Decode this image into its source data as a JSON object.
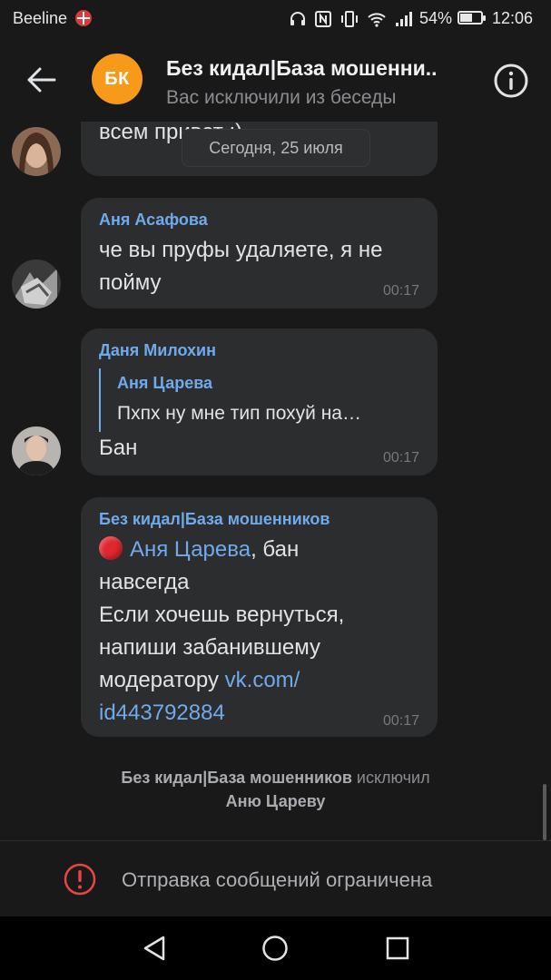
{
  "status_bar": {
    "carrier": "Beeline",
    "battery": "54%",
    "time": "12:06"
  },
  "header": {
    "avatar_initials": "БК",
    "avatar_color": "#f79a1a",
    "title": "Без кидал|База мошенни..",
    "subtitle": "Вас исключили из беседы"
  },
  "feed": {
    "date_separator": "Сегодня, 25 июля",
    "partial_message": "всем привет :)",
    "messages": [
      {
        "sender": "Аня Асафова",
        "lines": [
          "че вы пруфы удаляете, я не",
          "пойму"
        ],
        "time": "00:17"
      },
      {
        "sender": "Даня Милохин",
        "reply_to_name": "Аня Царева",
        "reply_to_text": "Пхпх ну мне тип похуй на…",
        "text": "Бан",
        "time": "00:17"
      },
      {
        "sender": "Без кидал|База мошенников",
        "mention": "Аня Царева",
        "mention_suffix": ", бан",
        "lines": [
          "навсегда",
          "Если хочешь вернуться,",
          "напиши забанившему"
        ],
        "line_last_prefix": "модератору ",
        "link_part1": "vk.com/",
        "link_part2": "id443792884",
        "time": "00:17"
      }
    ],
    "service_message": {
      "actor": "Без кидал|База мошенников",
      "action": " исключил",
      "target": "Аню Цареву"
    }
  },
  "restriction": {
    "text": "Отправка сообщений ограничена",
    "icon_color": "#e64646"
  },
  "accent_color": "#71aaeb"
}
